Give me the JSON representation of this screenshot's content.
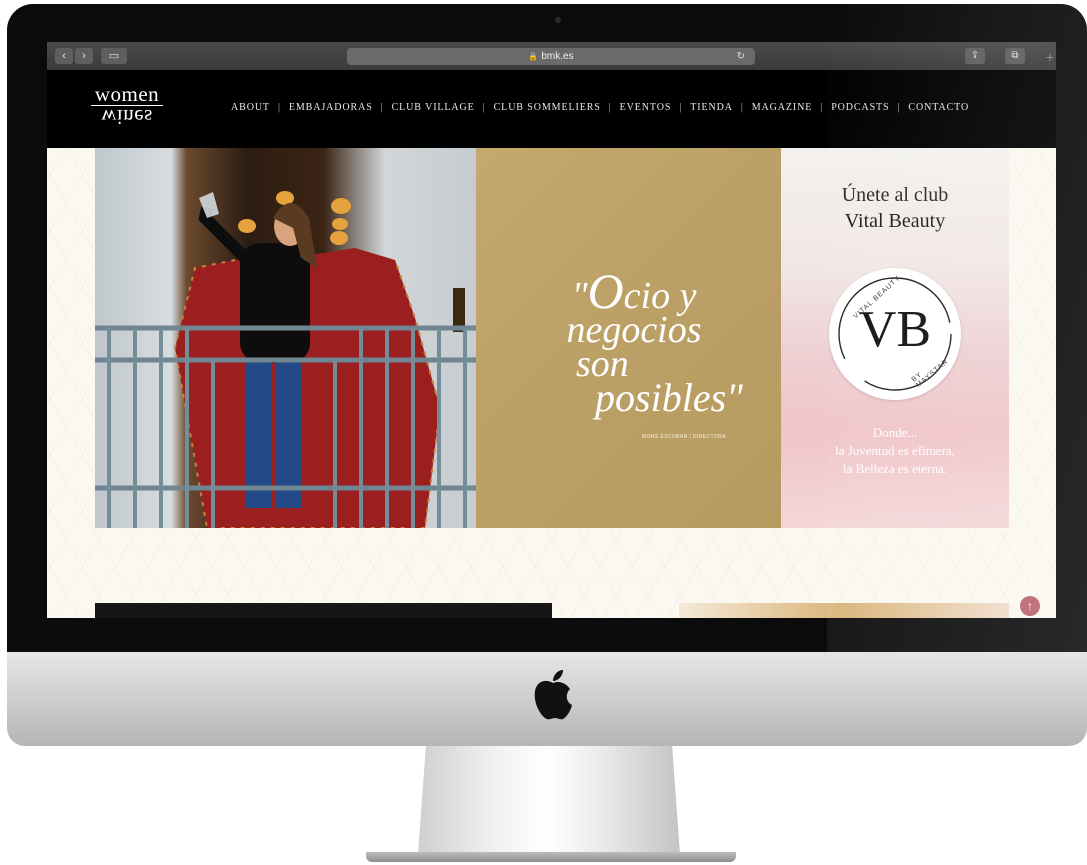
{
  "browser": {
    "url": "bmk.es",
    "back_icon": "chevron-left-icon",
    "forward_icon": "chevron-right-icon",
    "sidebar_icon": "sidebar-icon",
    "share_icon": "share-icon",
    "tabs_icon": "tabs-icon",
    "reload_icon": "reload-icon",
    "lock_icon": "lock-icon"
  },
  "site": {
    "logo_top": "women",
    "logo_bottom": "wines",
    "menu": [
      "ABOUT",
      "EMBAJADORAS",
      "CLUB VILLAGE",
      "CLUB SOMMELIERS",
      "EVENTOS",
      "TIENDA",
      "MAGAZINE",
      "PODCASTS",
      "CONTACTO"
    ]
  },
  "hero": {
    "quote_line1_open": "\"",
    "quote_line1_big": "O",
    "quote_line1_rest": "cio y",
    "quote_line2": "negocios",
    "quote_line3": "son",
    "quote_line4": "posibles\"",
    "quote_credit": "MONS ESCOBAR | DIRECTORA",
    "club_title_1": "Únete al club",
    "club_title_2": "Vital Beauty",
    "badge_monogram": "VB",
    "badge_arc_top": "VITAL BEAUTY",
    "badge_arc_bottom": "BY MAYSTAR",
    "club_copy_1": "Donde...",
    "club_copy_2": "la Juventud es efímera,",
    "club_copy_3": "la Belleza es eterna."
  },
  "colors": {
    "header_bg": "#000000",
    "gold_panel": "#bfa466",
    "accent_scroll": "#b9636b"
  }
}
